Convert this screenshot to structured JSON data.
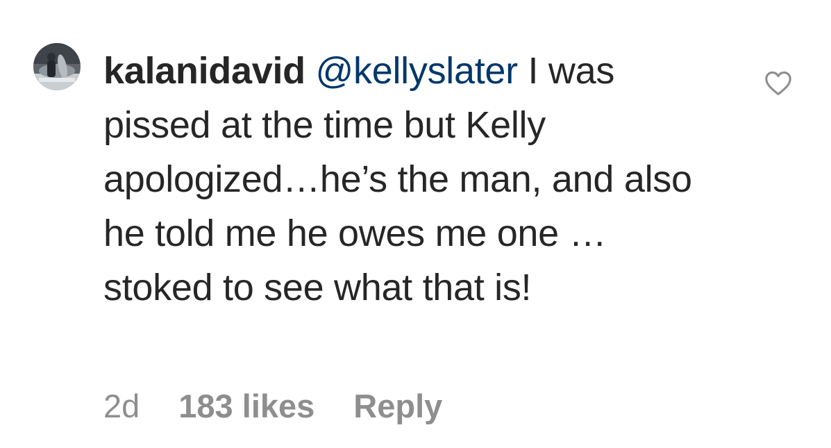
{
  "comment": {
    "username": "kalanidavid",
    "mention": "@kellyslater",
    "text": "I was pissed at the time but Kelly apologized…he’s the man, and also he told me he owes me one …stoked to see what that is!",
    "timestamp": "2d",
    "likes": "183 likes",
    "reply_label": "Reply"
  },
  "icons": {
    "avatar": "profile-photo",
    "like": "heart-outline-icon"
  },
  "colors": {
    "text": "#262626",
    "mention": "#00376b",
    "meta": "#8e8e8e",
    "icon": "#8e8e8e"
  }
}
